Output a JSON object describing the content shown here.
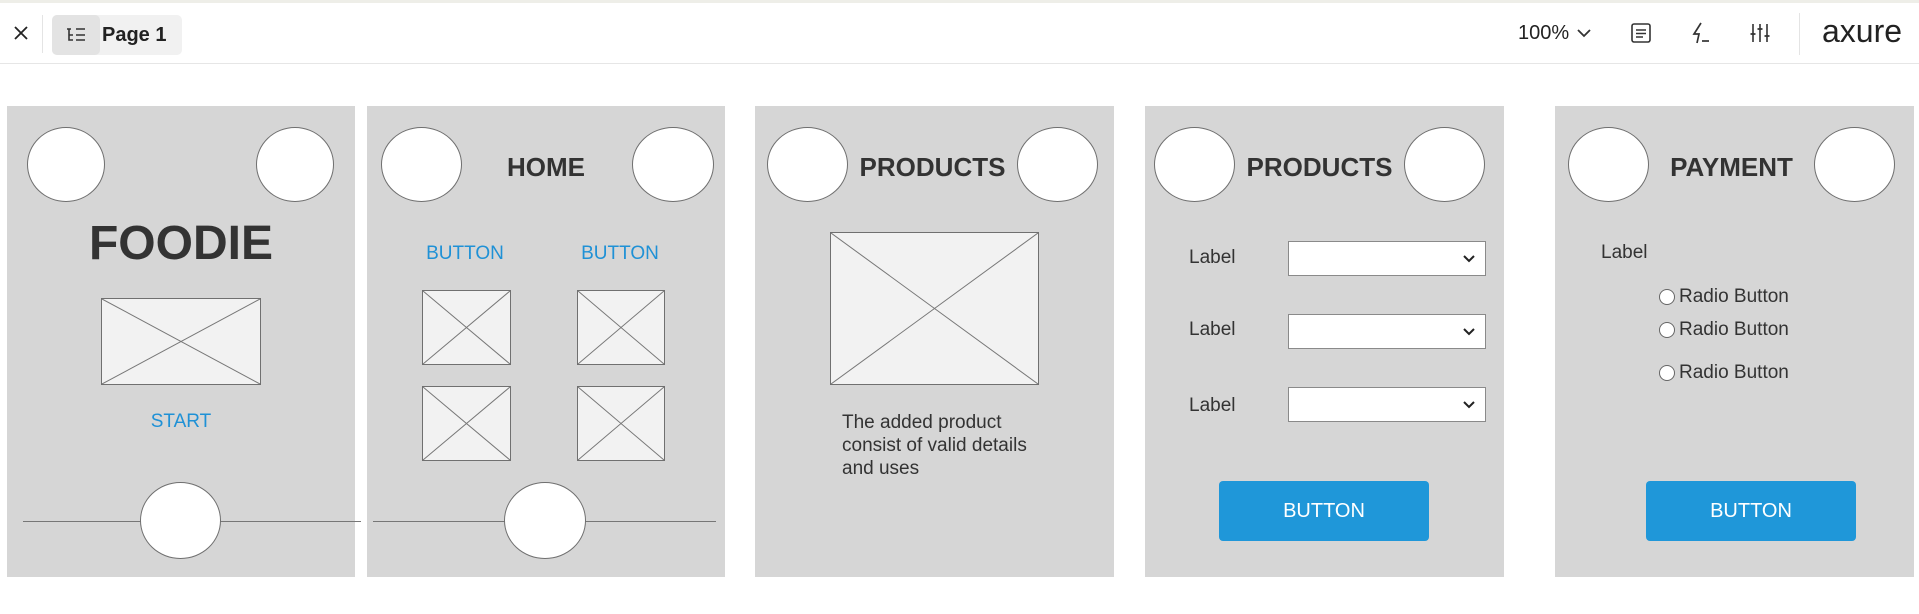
{
  "toolbar": {
    "page_label": "Page 1",
    "zoom": "100%",
    "brand": "axure"
  },
  "screens": [
    {
      "title": "FOODIE",
      "link": "START"
    },
    {
      "title": "HOME",
      "buttons": [
        "BUTTON",
        "BUTTON"
      ]
    },
    {
      "title": "PRODUCTS",
      "description": "The added product consist of valid details and uses"
    },
    {
      "title": "PRODUCTS",
      "labels": [
        "Label",
        "Label",
        "Label"
      ],
      "button": "BUTTON"
    },
    {
      "title": "PAYMENT",
      "label": "Label",
      "radios": [
        "Radio Button",
        "Radio Button",
        "Radio Button"
      ],
      "button": "BUTTON"
    }
  ]
}
